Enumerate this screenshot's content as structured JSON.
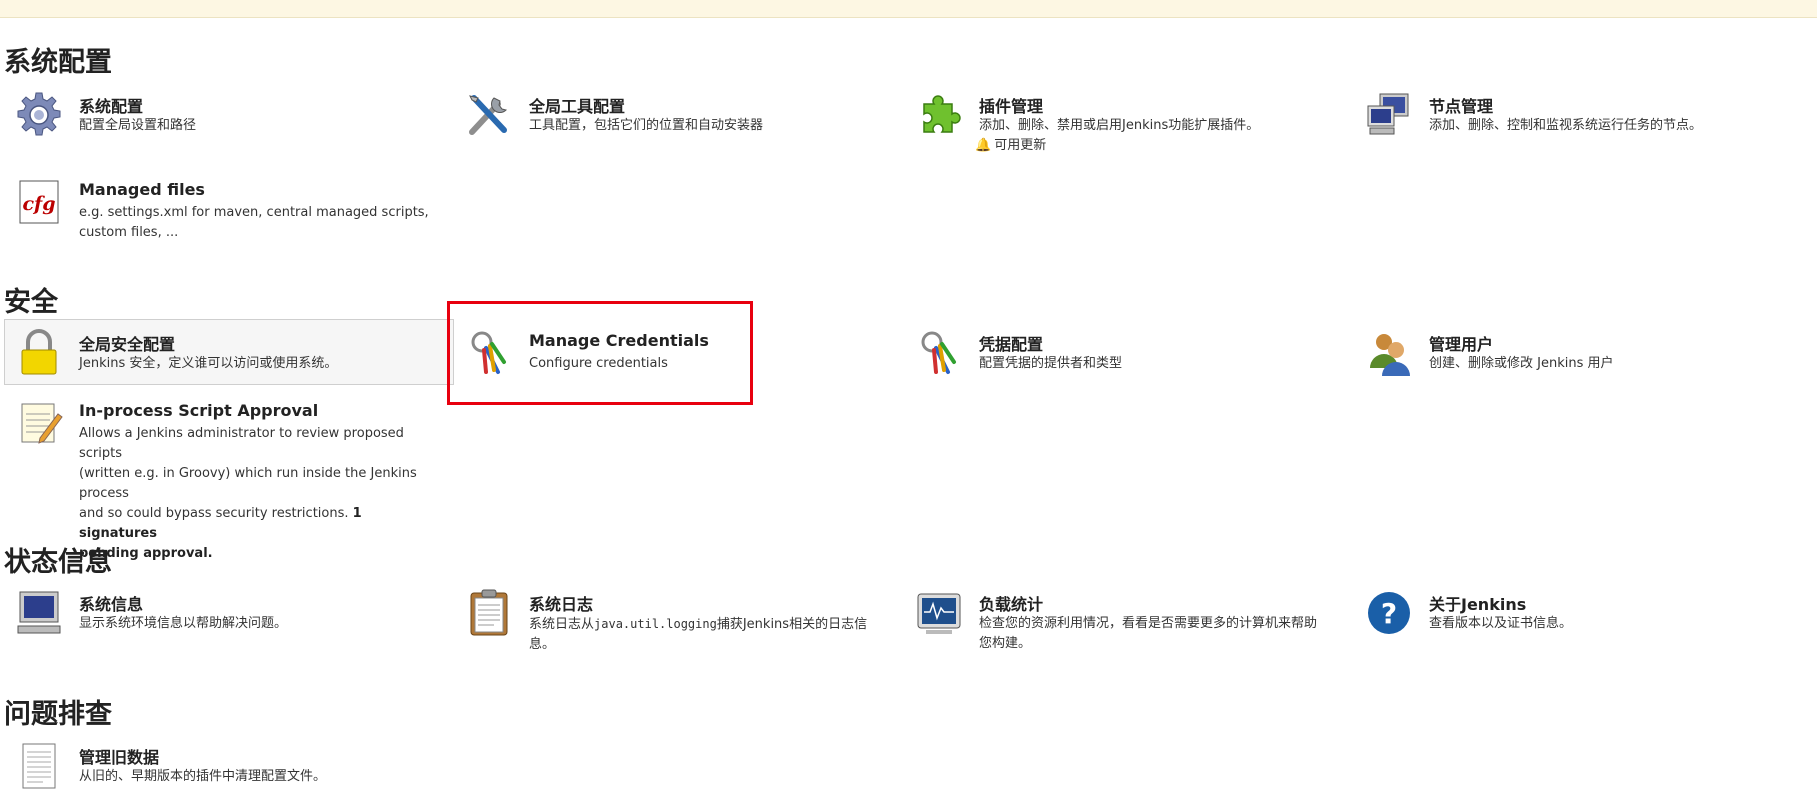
{
  "sections": [
    {
      "title": "系统配置",
      "items": [
        {
          "title": "系统配置",
          "desc": "配置全局设置和路径",
          "icon": "gear-icon"
        },
        {
          "title": "全局工具配置",
          "desc": "工具配置，包括它们的位置和自动安装器",
          "icon": "tools-icon"
        },
        {
          "title": "插件管理",
          "desc": "添加、删除、禁用或启用Jenkins功能扩展插件。",
          "icon": "puzzle-icon",
          "badge": "可用更新"
        },
        {
          "title": "节点管理",
          "desc": "添加、删除、控制和监视系统运行任务的节点。",
          "icon": "computer-network-icon"
        },
        {
          "title": "Managed files",
          "desc_lines": [
            "e.g. settings.xml for maven, central managed scripts,",
            "custom files, ..."
          ],
          "icon": "cfg-file-icon"
        }
      ]
    },
    {
      "title": "安全",
      "items": [
        {
          "title": "全局安全配置",
          "desc": "Jenkins 安全，定义谁可以访问或使用系统。",
          "icon": "padlock-icon"
        },
        {
          "title": "Manage Credentials",
          "desc": "Configure credentials",
          "icon": "keys-icon"
        },
        {
          "title": "凭据配置",
          "desc": "配置凭据的提供者和类型",
          "icon": "keys-icon"
        },
        {
          "title": "管理用户",
          "desc": "创建、删除或修改 Jenkins 用户",
          "icon": "users-icon"
        },
        {
          "title": "In-process Script Approval",
          "desc_lines": [
            "Allows a Jenkins administrator to review proposed scripts",
            "(written e.g. in Groovy) which run inside the Jenkins process",
            "and so could bypass security restrictions."
          ],
          "desc_bold": "1 signatures",
          "desc_bold_2": "pending approval.",
          "icon": "notepad-pencil-icon"
        }
      ]
    },
    {
      "title": "状态信息",
      "items": [
        {
          "title": "系统信息",
          "desc": "显示系统环境信息以帮助解决问题。",
          "icon": "computer-icon"
        },
        {
          "title": "系统日志",
          "desc_pre": "系统日志从",
          "desc_code": "java.util.logging",
          "desc_post": "捕获Jenkins相关的日志信",
          "desc_line2": "息。",
          "icon": "clipboard-icon"
        },
        {
          "title": "负载统计",
          "desc_lines": [
            "检查您的资源利用情况，看看是否需要更多的计算机来帮助",
            "您构建。"
          ],
          "icon": "monitor-graph-icon"
        },
        {
          "title": "关于Jenkins",
          "desc": "查看版本以及证书信息。",
          "icon": "help-icon"
        }
      ]
    },
    {
      "title": "问题排查",
      "items": [
        {
          "title": "管理旧数据",
          "desc": "从旧的、早期版本的插件中清理配置文件。",
          "icon": "document-icon"
        }
      ]
    }
  ],
  "colors": {
    "highlight_border": "#e8000f",
    "banner_bg": "#fdf7e3",
    "update_bell": "#dd0000"
  }
}
